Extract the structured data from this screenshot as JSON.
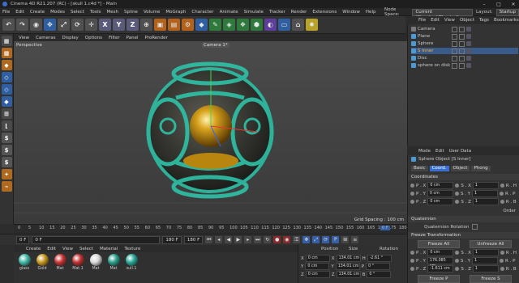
{
  "window": {
    "title": "Cinema 4D R21.207 (RC) - [skull 1.c4d *] - Main"
  },
  "menubar": [
    "File",
    "Edit",
    "Create",
    "Modes",
    "Select",
    "Tools",
    "Mesh",
    "Spline",
    "Volume",
    "MoGraph",
    "Character",
    "Animate",
    "Simulate",
    "Tracker",
    "Render",
    "Extensions",
    "Window",
    "Help"
  ],
  "nodespace": {
    "label": "Node Space:",
    "value": "Current (Standard/Physical)",
    "layout_label": "Layout:",
    "layout_value": "Startup"
  },
  "toolbar": {
    "axis_x": "X",
    "axis_y": "Y",
    "axis_z": "Z"
  },
  "viewport": {
    "menu": [
      "View",
      "Cameras",
      "Display",
      "Options",
      "Filter",
      "Panel",
      "ProRender"
    ],
    "name": "Perspective",
    "camera": "Camera 1*",
    "grid_spacing": "Grid Spacing : 100 cm",
    "colors": {
      "shell": "#2fc2a8",
      "gold": "#d8a21c"
    }
  },
  "timeline": {
    "ticks": [
      "0",
      "5",
      "10",
      "15",
      "20",
      "25",
      "30",
      "35",
      "40",
      "45",
      "50",
      "55",
      "60",
      "65",
      "70",
      "75",
      "80",
      "85",
      "90",
      "95",
      "100",
      "105",
      "110",
      "115",
      "120",
      "125",
      "130",
      "135",
      "140",
      "145",
      "150",
      "155",
      "160",
      "165",
      "170",
      "175",
      "180"
    ],
    "current_frame_marker": "0 F",
    "start": "0 F",
    "start2": "0 F",
    "end": "180 F",
    "end2": "180 F"
  },
  "materials": {
    "menu": [
      "Create",
      "Edit",
      "View",
      "Select",
      "Material",
      "Texture"
    ],
    "items": [
      {
        "name": "glass",
        "color": "#3fb8a6"
      },
      {
        "name": "Gold",
        "color": "#c8971f"
      },
      {
        "name": "Mat",
        "color": "#c83333"
      },
      {
        "name": "Mat.1",
        "color": "#c03030"
      },
      {
        "name": "Mat",
        "color": "#d8d8d8"
      },
      {
        "name": "Mat",
        "color": "#2a9d8b"
      },
      {
        "name": "sull.1",
        "color": "#28a898"
      }
    ]
  },
  "coordinates": {
    "headers": [
      "Position",
      "Size",
      "Rotation"
    ],
    "rows": [
      {
        "axis": "X",
        "pos": "0 cm",
        "size": "134.01 cm",
        "rot_axis": "H",
        "rot": "-2.61 °"
      },
      {
        "axis": "Y",
        "pos": "0 cm",
        "size": "134.01 cm",
        "rot_axis": "P",
        "rot": "0 °"
      },
      {
        "axis": "Z",
        "pos": "0 cm",
        "size": "134.01 cm",
        "rot_axis": "B",
        "rot": "0 °"
      }
    ],
    "mode": "Object (Rel)",
    "size_mode": "Size",
    "apply": "Apply"
  },
  "objects": {
    "menu": [
      "File",
      "Edit",
      "View",
      "Object",
      "Tags",
      "Bookmarks"
    ],
    "items": [
      {
        "name": "Camera",
        "color": "#7a7a7a"
      },
      {
        "name": "Plane",
        "color": "#4a9ad4"
      },
      {
        "name": "Sphere",
        "color": "#4a9ad4"
      },
      {
        "name": "S Inner",
        "color": "#4a9ad4",
        "selected": true
      },
      {
        "name": "Disc",
        "color": "#4a9ad4"
      },
      {
        "name": "sphere on disk",
        "color": "#4a9ad4"
      }
    ]
  },
  "attributes": {
    "menu": [
      "Mode",
      "Edit",
      "User Data"
    ],
    "title": "Sphere Object [S Inner]",
    "tabs": [
      "Basic",
      "Coord.",
      "Object",
      "Phong"
    ],
    "active_tab": "Coord.",
    "coord_section": "Coordinates",
    "rows": [
      {
        "p_axis": "P . X",
        "p_val": "0 cm",
        "s_axis": "S . X",
        "s_val": "1",
        "r_axis": "R . H"
      },
      {
        "p_axis": "P . Y",
        "p_val": "0 cm",
        "s_axis": "S . Y",
        "s_val": "1",
        "r_axis": "R . P"
      },
      {
        "p_axis": "P . Z",
        "p_val": "0 cm",
        "s_axis": "S . Z",
        "s_val": "1",
        "r_axis": "R . B"
      }
    ],
    "order_label": "Order",
    "quaternion_section": "Quaternion",
    "quaternion_rotation": "Quaternion Rotation",
    "freeze_section": "Freeze Transformation",
    "freeze_all": "Freeze All",
    "unfreeze_all": "Unfreeze All",
    "freeze_rows": [
      {
        "p_axis": "P . X",
        "p_val": "0 cm",
        "s_axis": "S . X",
        "s_val": "1",
        "r_axis": "R . H"
      },
      {
        "p_axis": "P . Y",
        "p_val": "176.085 cm",
        "s_axis": "S . Y",
        "s_val": "1",
        "r_axis": "R . P"
      },
      {
        "p_axis": "P . Z",
        "p_val": "-1.611 cm",
        "s_axis": "S . Z",
        "s_val": "1",
        "r_axis": "R . B"
      }
    ],
    "freeze_p": "Freeze P",
    "freeze_s": "Freeze S"
  }
}
